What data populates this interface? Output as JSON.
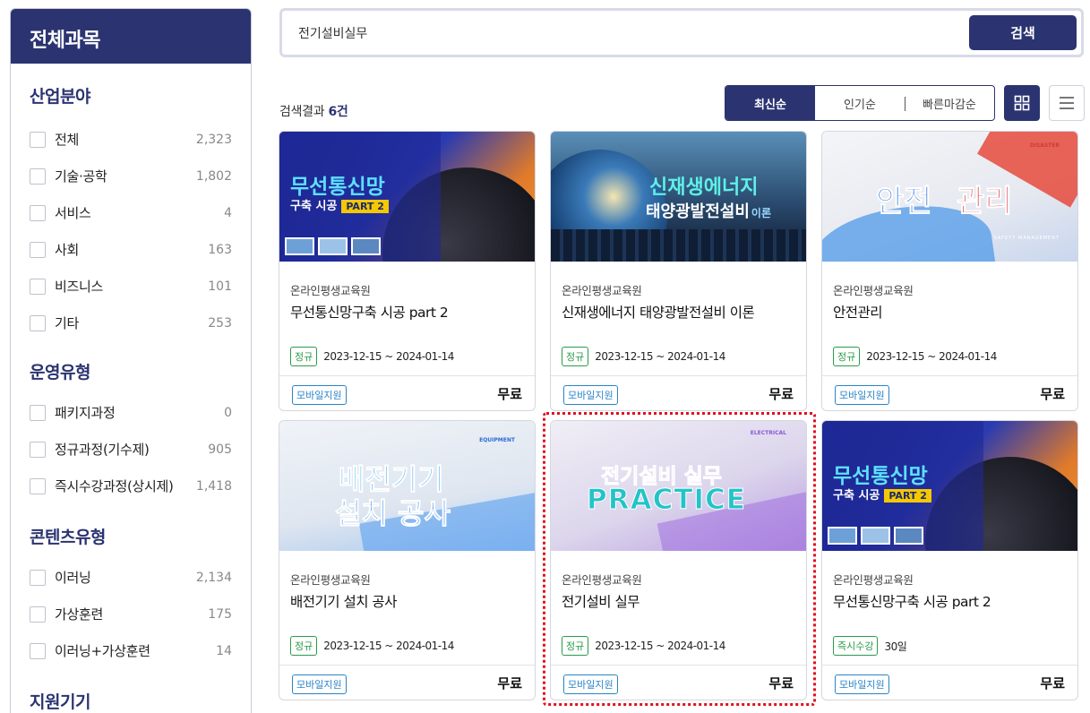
{
  "sidebar": {
    "title": "전체과목",
    "groups": [
      {
        "title": "산업분야",
        "items": [
          {
            "label": "전체",
            "count": "2,323"
          },
          {
            "label": "기술·공학",
            "count": "1,802"
          },
          {
            "label": "서비스",
            "count": "4"
          },
          {
            "label": "사회",
            "count": "163"
          },
          {
            "label": "비즈니스",
            "count": "101"
          },
          {
            "label": "기타",
            "count": "253"
          }
        ]
      },
      {
        "title": "운영유형",
        "items": [
          {
            "label": "패키지과정",
            "count": "0"
          },
          {
            "label": "정규과정(기수제)",
            "count": "905"
          },
          {
            "label": "즉시수강과정(상시제)",
            "count": "1,418"
          }
        ]
      },
      {
        "title": "콘텐츠유형",
        "items": [
          {
            "label": "이러닝",
            "count": "2,134"
          },
          {
            "label": "가상훈련",
            "count": "175"
          },
          {
            "label": "이러닝+가상훈련",
            "count": "14"
          }
        ]
      },
      {
        "title": "지원기기",
        "items": []
      }
    ]
  },
  "search": {
    "value": "전기설비실무",
    "button_label": "검색"
  },
  "results": {
    "label_prefix": "검색결과 ",
    "count": "6건"
  },
  "sort": {
    "tabs": [
      "최신순",
      "인기순",
      "빠른마감순"
    ],
    "active": "최신순"
  },
  "cards": [
    {
      "provider": "온라인평생교육원",
      "title": "무선통신망구축 시공 part 2",
      "type_badge": "정규",
      "period": "2023-12-15 ~ 2024-01-14",
      "mobile_badge": "모바일지원",
      "price": "무료",
      "thumb": {
        "line1": "무선통신망",
        "line2": "구축 시공",
        "tag": "PART 2"
      }
    },
    {
      "provider": "온라인평생교육원",
      "title": "신재생에너지 태양광발전설비 이론",
      "type_badge": "정규",
      "period": "2023-12-15 ~ 2024-01-14",
      "mobile_badge": "모바일지원",
      "price": "무료",
      "thumb": {
        "line1": "신재생에너지",
        "line2": "태양광발전설비",
        "suffix": "이론"
      }
    },
    {
      "provider": "온라인평생교육원",
      "title": "안전관리",
      "type_badge": "정규",
      "period": "2023-12-15 ~ 2024-01-14",
      "mobile_badge": "모바일지원",
      "price": "무료",
      "thumb": {
        "word1": "안전",
        "word2": "관리",
        "small1": "DISASTER",
        "small2": "SAFETY MANAGEMENT"
      }
    },
    {
      "provider": "온라인평생교육원",
      "title": "배전기기 설치 공사",
      "type_badge": "정규",
      "period": "2023-12-15 ~ 2024-01-14",
      "mobile_badge": "모바일지원",
      "price": "무료",
      "thumb": {
        "line1": "배전기기",
        "line2": "설치 공사",
        "small1": "EQUIPMENT"
      }
    },
    {
      "provider": "온라인평생교육원",
      "title": "전기설비 실무",
      "type_badge": "정규",
      "period": "2023-12-15 ~ 2024-01-14",
      "mobile_badge": "모바일지원",
      "price": "무료",
      "thumb": {
        "line1": "전기설비 실무",
        "line2": "PRACTICE",
        "small1": "ELECTRICAL"
      }
    },
    {
      "provider": "온라인평생교육원",
      "title": "무선통신망구축 시공 part 2",
      "type_badge": "즉시수강",
      "period": "30일",
      "mobile_badge": "모바일지원",
      "price": "무료",
      "thumb": {
        "line1": "무선통신망",
        "line2": "구축 시공",
        "tag": "PART 2"
      }
    }
  ],
  "colors": {
    "brand": "#2b3471",
    "regular_badge": "#2a9a4a",
    "mobile_badge": "#2a84c8",
    "highlight": "#e0101e"
  }
}
